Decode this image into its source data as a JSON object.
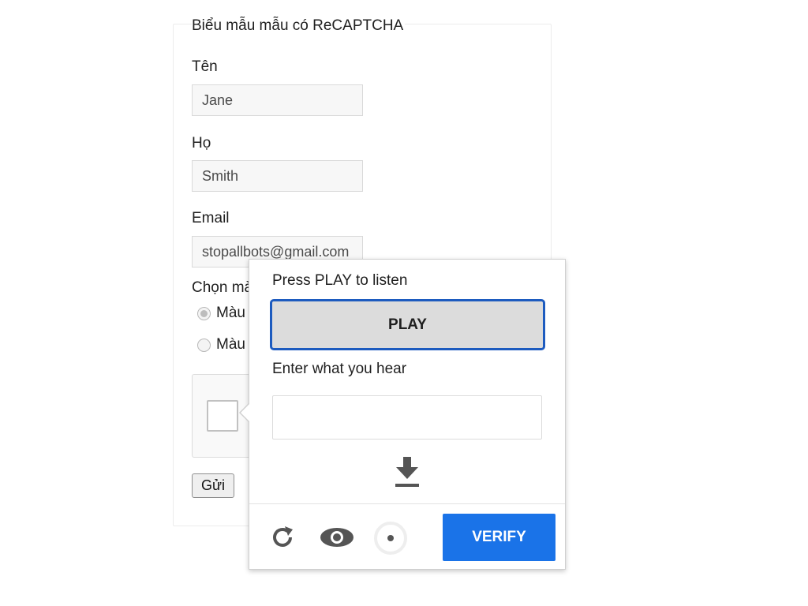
{
  "form": {
    "title": "Biểu mẫu mẫu có ReCAPTCHA",
    "first_name": {
      "label": "Tên",
      "value": "Jane"
    },
    "last_name": {
      "label": "Họ",
      "value": "Smith"
    },
    "email": {
      "label": "Email",
      "value": "stopallbots@gmail.com"
    },
    "color": {
      "label": "Chọn mà",
      "options": [
        {
          "label": "Màu",
          "checked": true
        },
        {
          "label": "Màu",
          "checked": false
        }
      ]
    },
    "submit_label": "Gửi"
  },
  "challenge": {
    "play_prompt": "Press PLAY to listen",
    "play_label": "PLAY",
    "answer_prompt": "Enter what you hear",
    "answer_value": "",
    "verify_label": "VERIFY",
    "icons": [
      "download-icon",
      "reload-icon",
      "eye-icon",
      "audio-icon"
    ],
    "accent_color": "#1a73e8",
    "play_border_color": "#1d5bbf"
  }
}
